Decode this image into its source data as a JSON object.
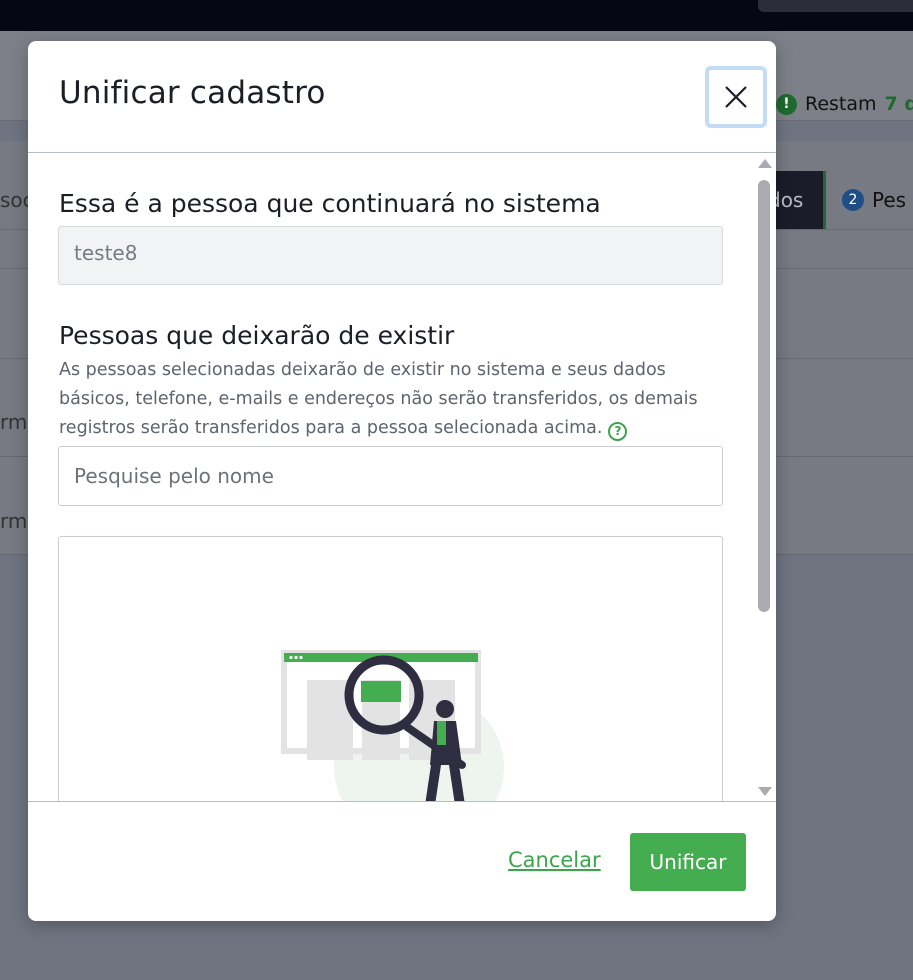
{
  "background": {
    "remaining_label": "Restam",
    "remaining_count": "7 d",
    "tab_dark_fragment": "dos",
    "tab2_number": "2",
    "tab2_label": "Pes",
    "left_fragment_1": "soc",
    "left_fragment_2": "rm",
    "left_fragment_3": "rm"
  },
  "modal": {
    "title": "Unificar cadastro",
    "close_icon": "close-icon",
    "keep_section": {
      "label": "Essa é a pessoa que continuará no sistema",
      "value": "teste8"
    },
    "remove_section": {
      "label": "Pessoas que deixarão de existir",
      "hint": "As pessoas selecionadas deixarão de existir no sistema e seus dados básicos, telefone, e-mails e endereços não serão transferidos, os demais registros serão transferidos para a pessoa selecionada acima.",
      "help_icon": "question-circle-icon",
      "help_glyph": "?",
      "search_placeholder": "Pesquise pelo nome"
    },
    "footer": {
      "cancel_label": "Cancelar",
      "confirm_label": "Unificar"
    }
  },
  "colors": {
    "accent": "#44ad50",
    "overlay": "#6f7480",
    "close_focus_ring": "#c3dcf5"
  }
}
